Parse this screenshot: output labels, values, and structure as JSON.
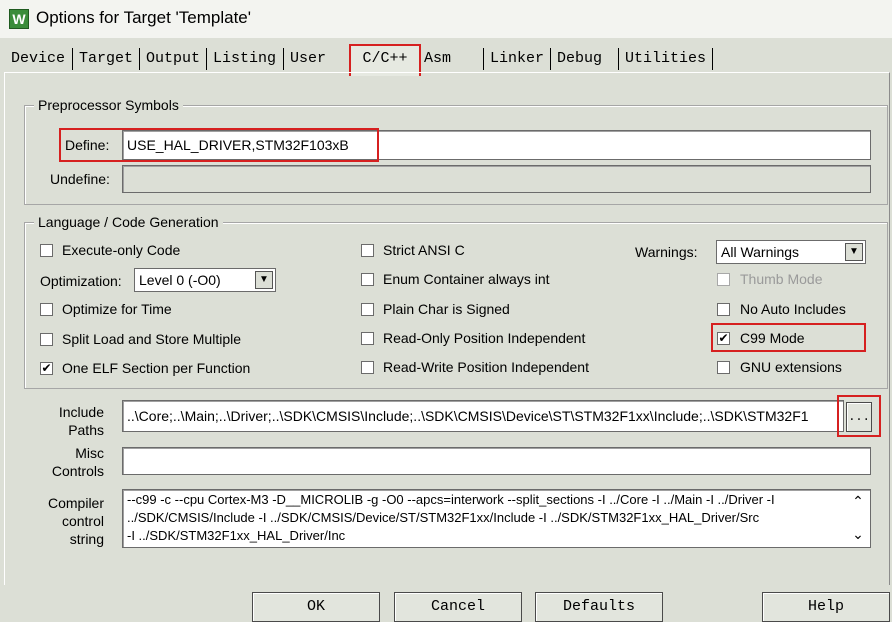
{
  "window": {
    "title": "Options for Target 'Template'",
    "app_icon_glyph": "W"
  },
  "tabs": [
    {
      "label": "Device"
    },
    {
      "label": "Target"
    },
    {
      "label": "Output"
    },
    {
      "label": "Listing"
    },
    {
      "label": "User"
    },
    {
      "label": "C/C++"
    },
    {
      "label": "Asm"
    },
    {
      "label": "Linker"
    },
    {
      "label": "Debug"
    },
    {
      "label": "Utilities"
    }
  ],
  "preprocessor": {
    "legend": "Preprocessor Symbols",
    "define_label": "Define:",
    "define_value": "USE_HAL_DRIVER,STM32F103xB",
    "undefine_label": "Undefine:",
    "undefine_value": ""
  },
  "language": {
    "legend": "Language / Code Generation",
    "execute_only": "Execute-only Code",
    "optimization_label": "Optimization:",
    "optimization_value": "Level 0 (-O0)",
    "optimize_time": "Optimize for Time",
    "split_load": "Split Load and Store Multiple",
    "one_elf": "One ELF Section per Function",
    "strict_ansi": "Strict ANSI C",
    "enum_container": "Enum Container always int",
    "plain_char": "Plain Char is Signed",
    "ro_pi": "Read-Only Position Independent",
    "rw_pi": "Read-Write Position Independent",
    "warnings_label": "Warnings:",
    "warnings_value": "All Warnings",
    "thumb_mode": "Thumb Mode",
    "no_auto_includes": "No Auto Includes",
    "c99_mode": "C99 Mode",
    "gnu_ext": "GNU extensions"
  },
  "paths": {
    "include_label_1": "Include",
    "include_label_2": "Paths",
    "include_value": "..\\Core;..\\Main;..\\Driver;..\\SDK\\CMSIS\\Include;..\\SDK\\CMSIS\\Device\\ST\\STM32F1xx\\Include;..\\SDK\\STM32F1",
    "browse_label": "...",
    "misc_label_1": "Misc",
    "misc_label_2": "Controls",
    "misc_value": "",
    "compiler_label_1": "Compiler",
    "compiler_label_2": "control",
    "compiler_label_3": "string",
    "compiler_line_1": "--c99 -c --cpu Cortex-M3 -D__MICROLIB -g -O0 --apcs=interwork --split_sections -I ../Core -I ../Main -I ../Driver -I",
    "compiler_line_2": "../SDK/CMSIS/Include -I ../SDK/CMSIS/Device/ST/STM32F1xx/Include -I ../SDK/STM32F1xx_HAL_Driver/Src",
    "compiler_line_3": "-I ../SDK/STM32F1xx_HAL_Driver/Inc"
  },
  "buttons": {
    "ok": "OK",
    "cancel": "Cancel",
    "defaults": "Defaults",
    "help": "Help"
  },
  "glyphs": {
    "check": "✔",
    "combo_arrow": "▼",
    "scroll_up": "⌃",
    "scroll_down": "⌄"
  },
  "colors": {
    "highlight_red": "#d62020",
    "dialog_bg": "#dcdfd6"
  }
}
